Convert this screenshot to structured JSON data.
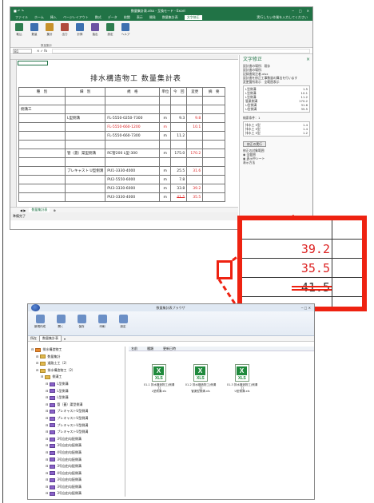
{
  "excel": {
    "title": "数量集計表.xlsx - 互換モード - Excel",
    "tabs": [
      "ファイル",
      "ホーム",
      "挿入",
      "ページレイアウト",
      "数式",
      "データ",
      "校閲",
      "表示",
      "開発",
      "数量集計表",
      "文字修正"
    ],
    "active_tab": "文字修正",
    "tellme": "実行したい作業を入力してください",
    "ribbon_buttons": [
      "取込",
      "数量",
      "集計",
      "出力",
      "計算",
      "抽出",
      "設定",
      "ヘルプ"
    ],
    "ribbon_group": "数量集計",
    "namebox": "B1",
    "sheet_title": "排水構造物工 数量集計表",
    "sheet_tab": "数量集計表",
    "status": "準備完了",
    "table": {
      "headers": [
        "種　別",
        "細　別",
        "規　格",
        "単位",
        "今　回",
        "変更",
        "摘　要"
      ],
      "rows": [
        {
          "type": "",
          "cat": "",
          "spec": "",
          "unit": "",
          "a": "",
          "b": "",
          "note": ""
        },
        {
          "type": "側溝工",
          "cat": "",
          "spec": "",
          "unit": "",
          "a": "",
          "b": "",
          "note": ""
        },
        {
          "type": "",
          "cat": "L型側溝",
          "spec": "FL-5550-0250-7300",
          "unit": "m",
          "a": "9.3",
          "b": "9.8",
          "note": ""
        },
        {
          "type": "",
          "cat": "",
          "spec": "FL-5550-660-1200",
          "unit": "m",
          "a": "",
          "b": "10.1",
          "note": ""
        },
        {
          "type": "",
          "cat": "",
          "spec": "FL-5550-660-7300",
          "unit": "m",
          "a": "11.2",
          "b": "",
          "note": ""
        },
        {
          "type": "",
          "cat": "",
          "spec": "",
          "unit": "",
          "a": "",
          "b": "",
          "note": ""
        },
        {
          "type": "",
          "cat": "管（蓋）渠型側溝",
          "spec": "RC管200 L型-300",
          "unit": "m",
          "a": "175.0",
          "b": "170.2",
          "note": ""
        },
        {
          "type": "",
          "cat": "",
          "spec": "",
          "unit": "",
          "a": "",
          "b": "",
          "note": ""
        },
        {
          "type": "",
          "cat": "プレキャスト U型側溝",
          "spec": "PU1-3330-4000",
          "unit": "m",
          "a": "25.5",
          "b": "31.6",
          "note": ""
        },
        {
          "type": "",
          "cat": "",
          "spec": "PU2-5550-6000",
          "unit": "m",
          "a": "7.8",
          "b": "",
          "note": ""
        },
        {
          "type": "",
          "cat": "",
          "spec": "PU3-3330-6000",
          "unit": "m",
          "a": "33.8",
          "b": "39.2",
          "note": ""
        },
        {
          "type": "",
          "cat": "",
          "spec": "PU3-3330-4000",
          "unit": "m",
          "a": "41.5",
          "b": "35.5",
          "note": ""
        }
      ]
    },
    "pane": {
      "title": "文字修正",
      "lines": [
        "設計書の場所：既存",
        "設計書の場所：",
        "記録書発注者.xlsx",
        "設計書を修正工事数量の算出を行います",
        "変更箇所表示　全範囲表示"
      ],
      "list": [
        {
          "k": "L型側溝",
          "v": "1.5"
        },
        {
          "k": "L型側溝",
          "v": "10.1"
        },
        {
          "k": "L型側溝",
          "v": "11.2"
        },
        {
          "k": "管渠側溝",
          "v": "170.2"
        },
        {
          "k": "U型側溝",
          "v": "31.6"
        },
        {
          "k": "U型側溝",
          "v": "35.5"
        }
      ],
      "section2": "検索条件：1",
      "list2": [
        {
          "k": "排水工 S型",
          "v": "1.4"
        },
        {
          "k": "排水工 S型",
          "v": "1.4"
        },
        {
          "k": "排水工 S型",
          "v": "1.2"
        }
      ],
      "button": "修正の実行",
      "options": [
        "修正の対象範囲",
        "全範囲",
        "表示中シート",
        "表示方法"
      ]
    }
  },
  "zoom": {
    "values": [
      "39.2",
      "35.5",
      "41.5"
    ]
  },
  "explorer": {
    "title": "数量集計表ブラウザ",
    "ribbon_buttons": [
      "新規作成",
      "開く",
      "保存",
      "印刷",
      "設定"
    ],
    "address": "数量集計表",
    "address_label": "所在",
    "file_header": [
      "名前",
      "種類",
      "更新日時"
    ],
    "tree": [
      {
        "label": "排水構造物工",
        "kind": "o",
        "depth": 0
      },
      {
        "label": "数量集計",
        "kind": "y",
        "depth": 1
      },
      {
        "label": "道路土工（2）",
        "kind": "y",
        "depth": 1
      },
      {
        "label": "排水構造物工（2）",
        "kind": "y",
        "depth": 1
      },
      {
        "label": "側溝工",
        "kind": "y",
        "depth": 2
      },
      {
        "label": "L型側溝",
        "kind": "p",
        "depth": 3
      },
      {
        "label": "L型側溝",
        "kind": "p",
        "depth": 3
      },
      {
        "label": "L型側溝",
        "kind": "p",
        "depth": 3
      },
      {
        "label": "管（蓋）渠型側溝",
        "kind": "p",
        "depth": 3
      },
      {
        "label": "プレキャストU型側溝",
        "kind": "p",
        "depth": 3
      },
      {
        "label": "プレキャストU型側溝",
        "kind": "p",
        "depth": 3
      },
      {
        "label": "プレキャストU型側溝",
        "kind": "p",
        "depth": 3
      },
      {
        "label": "プレキャストU型側溝",
        "kind": "p",
        "depth": 3
      },
      {
        "label": "3号自由勾配側溝",
        "kind": "p",
        "depth": 3
      },
      {
        "label": "3号自由勾配側溝",
        "kind": "p",
        "depth": 3
      },
      {
        "label": "4号自由勾配側溝",
        "kind": "p",
        "depth": 3
      },
      {
        "label": "3号自由勾配側溝",
        "kind": "p",
        "depth": 3
      },
      {
        "label": "3号自由勾配側溝",
        "kind": "p",
        "depth": 3
      },
      {
        "label": "4号自由勾配側溝",
        "kind": "p",
        "depth": 3
      },
      {
        "label": "3号自由勾配側溝",
        "kind": "p",
        "depth": 3
      },
      {
        "label": "3号自由勾配側溝",
        "kind": "p",
        "depth": 3
      },
      {
        "label": "3号自由勾配側溝",
        "kind": "p",
        "depth": 3
      },
      {
        "label": "3号都市型自由勾配側溝",
        "kind": "p",
        "depth": 3
      }
    ],
    "files": [
      {
        "name": "01-1 排水構造物工(側溝工)",
        "sub": "L型側溝.xls"
      },
      {
        "name": "01-2 排水構造物工(側溝工)",
        "sub": "管渠型側溝.xls"
      },
      {
        "name": "01-3 排水構造物工(側溝工)",
        "sub": "U型側溝.xls"
      }
    ],
    "xls_label": "XLS"
  }
}
